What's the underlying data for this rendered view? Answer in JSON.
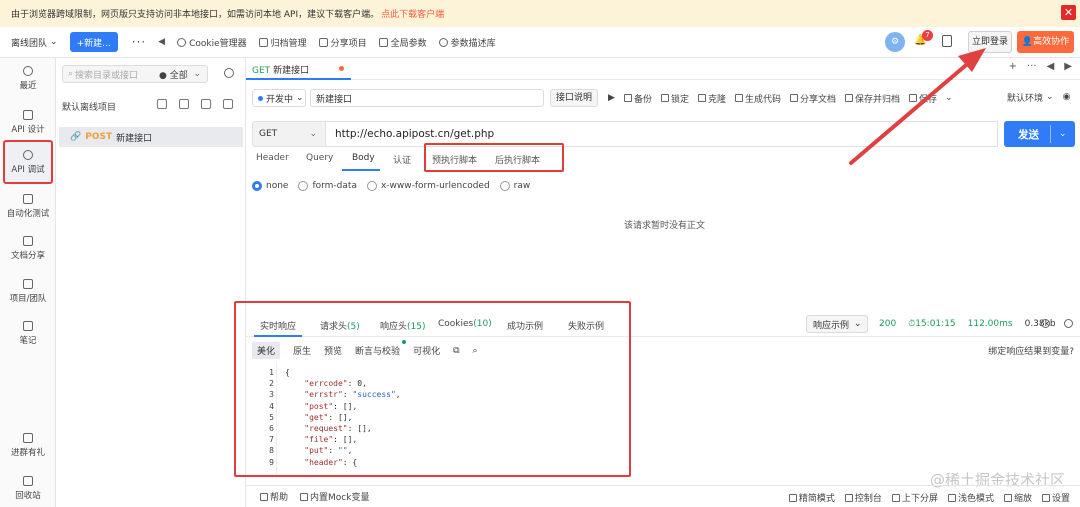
{
  "notice": {
    "text": "由于浏览器跨域限制，网页版只支持访问非本地接口，如需访问本地 API，建议下载客户端。",
    "link": "点此下载客户端",
    "close": "✕"
  },
  "topbar": {
    "team": "离线团队",
    "new_label": "+新建...",
    "more": "···",
    "back": "◀",
    "tools": [
      "Cookie管理器",
      "归档管理",
      "分享项目",
      "全局参数",
      "参数描述库"
    ],
    "avatar": "⚙",
    "badge": "7",
    "login": "立即登录",
    "collab": "高效协作"
  },
  "rail": {
    "items": [
      "最近",
      "API 设计",
      "API 调试",
      "自动化测试",
      "文档分享",
      "项目/团队",
      "笔记",
      "进群有礼",
      "回收站"
    ]
  },
  "tree": {
    "search_placeholder": "搜索目录或接口",
    "filter": "全部",
    "project": "默认离线项目",
    "row_method": "POST",
    "row_name": "新建接口"
  },
  "tab": {
    "method": "GET",
    "name": "新建接口",
    "ctrls": [
      "+",
      "···",
      "◀",
      "▶"
    ]
  },
  "meta": {
    "status": "开发中",
    "name_value": "新建接口",
    "explain": "接口说明",
    "actions": [
      "▶",
      "备份",
      "锁定",
      "克隆",
      "生成代码",
      "分享文档",
      "保存并归档",
      "保存"
    ],
    "env": "默认环境"
  },
  "request": {
    "method": "GET",
    "url": "http://echo.apipost.cn/get.php",
    "send": "发送",
    "tabs": [
      "Header",
      "Query",
      "Body",
      "认证",
      "预执行脚本",
      "后执行脚本"
    ],
    "body_types": [
      "none",
      "form-data",
      "x-www-form-urlencoded",
      "raw"
    ],
    "empty": "该请求暂时没有正文"
  },
  "response": {
    "tabs": [
      "实时响应",
      "请求头",
      "响应头",
      "Cookies",
      "成功示例",
      "失败示例"
    ],
    "counts": [
      "",
      "(5)",
      "(15)",
      "(10)",
      "",
      ""
    ],
    "example": "响应示例",
    "status": "200",
    "time": "15:01:15",
    "duration": "112.00ms",
    "size": "0.38kb",
    "views": [
      "美化",
      "原生",
      "预览",
      "断言与校验",
      "可视化"
    ],
    "bind": "绑定响应结果到变量?",
    "lines": [
      "1",
      "2",
      "3",
      "4",
      "5",
      "6",
      "7",
      "8",
      "9"
    ]
  },
  "watermark": "@稀土掘金技术社区",
  "footer": {
    "left": [
      "帮助",
      "内置Mock变量"
    ],
    "right": [
      "精简模式",
      "控制台",
      "上下分屏",
      "浅色模式",
      "缩放",
      "设置"
    ]
  },
  "colors": {
    "accent": "#2f7cf6",
    "annotation": "#e23c3c",
    "collab": "#ff6a3d",
    "success": "#1f9c5b"
  }
}
